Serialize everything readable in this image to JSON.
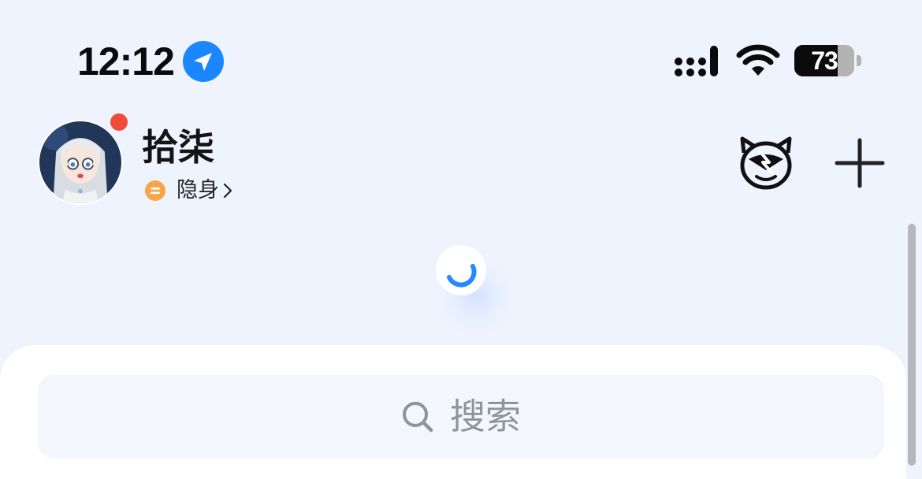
{
  "status_bar": {
    "time": "12:12",
    "location_icon": "location-arrow-icon",
    "signal_icon": "cellular-signal-icon",
    "wifi_icon": "wifi-icon",
    "battery_percent": 73,
    "battery_text": "73"
  },
  "profile": {
    "name": "拾柒",
    "status_label": "隐身",
    "status_icon": "invisible-status-icon",
    "has_notification_dot": true
  },
  "header_actions": {
    "mascot_icon": "qq-mascot-icon",
    "add_icon": "plus-icon"
  },
  "loading": {
    "spinner": "refresh-spinner-icon"
  },
  "search": {
    "placeholder": "搜索",
    "icon": "search-icon"
  },
  "colors": {
    "background": "#eef3fe",
    "accent_blue": "#1a86ff",
    "notification_red": "#f04b38",
    "status_orange": "#f7a548",
    "search_text": "#8f939b"
  }
}
